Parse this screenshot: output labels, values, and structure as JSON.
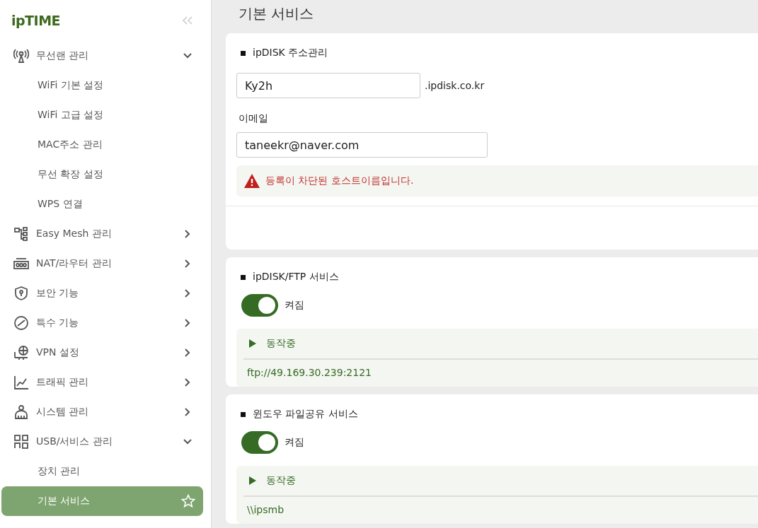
{
  "logo": "ipTIME",
  "sidebar": {
    "items": [
      {
        "label": "무선랜 관리",
        "expanded": true,
        "children": [
          {
            "label": "WiFi 기본 설정",
            "selected": false
          },
          {
            "label": "WiFi 고급 설정",
            "selected": false
          },
          {
            "label": "MAC주소 관리",
            "selected": false
          },
          {
            "label": "무선 확장 설정",
            "selected": false
          },
          {
            "label": "WPS 연결",
            "selected": false
          }
        ]
      },
      {
        "label": "Easy Mesh 관리",
        "expanded": false
      },
      {
        "label": "NAT/라우터 관리",
        "expanded": false
      },
      {
        "label": "보안 기능",
        "expanded": false
      },
      {
        "label": "특수 기능",
        "expanded": false
      },
      {
        "label": "VPN 설정",
        "expanded": false
      },
      {
        "label": "트래픽 관리",
        "expanded": false
      },
      {
        "label": "시스템 관리",
        "expanded": false
      },
      {
        "label": "USB/서비스 관리",
        "expanded": true,
        "children": [
          {
            "label": "장치 관리",
            "selected": false
          },
          {
            "label": "기본 서비스",
            "selected": true
          }
        ]
      }
    ]
  },
  "page_title": "기본 서비스",
  "ipdisk": {
    "title": "ipDISK 주소관리",
    "host": "Ky2h",
    "suffix": ".ipdisk.co.kr",
    "email_label": "이메일",
    "email": "taneekr@naver.com",
    "error": "등록이 차단된 호스트이름입니다."
  },
  "services": [
    {
      "title": "ipDISK/FTP 서비스",
      "on": true,
      "state_label": "켜짐",
      "status": "동작중",
      "address": "ftp://49.169.30.239:2121"
    },
    {
      "title": "윈도우 파일공유 서비스",
      "on": true,
      "state_label": "켜짐",
      "status": "동작중",
      "address": "\\\\ipsmb"
    }
  ]
}
